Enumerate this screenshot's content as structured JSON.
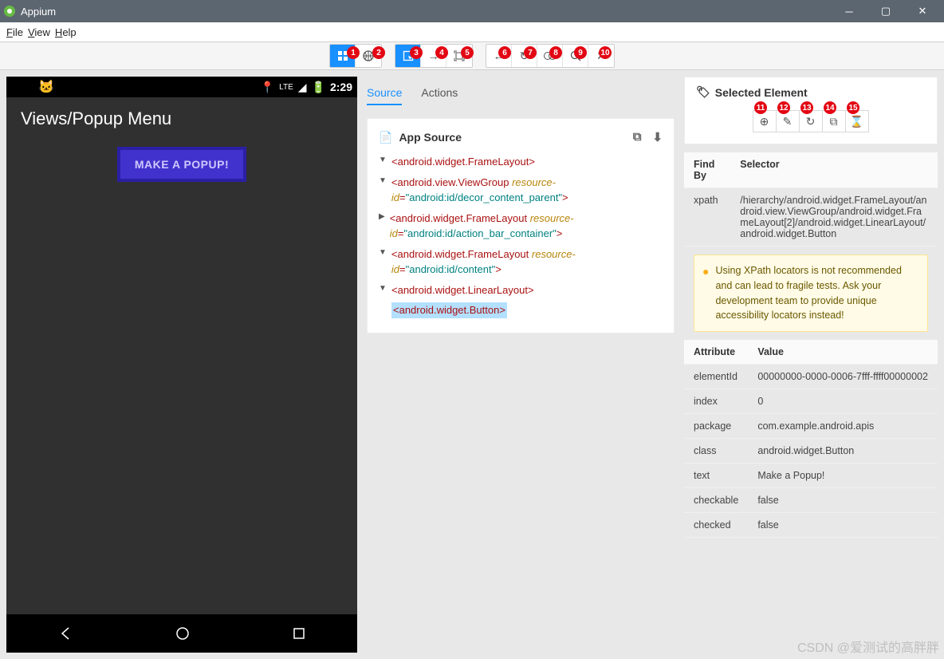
{
  "window": {
    "title": "Appium"
  },
  "menus": {
    "file": "File",
    "view": "View",
    "help": "Help"
  },
  "phone": {
    "clock": "2:29",
    "lte": "LTE",
    "page_title": "Views/Popup Menu",
    "button_label": "MAKE A POPUP!"
  },
  "tabs": {
    "source": "Source",
    "actions": "Actions"
  },
  "source_card": {
    "title": "App Source",
    "tree": {
      "n0": "android.widget.FrameLayout",
      "n1": "android.view.ViewGroup",
      "n1_attr_name": "resource-id",
      "n1_attr_val": "\"android:id/decor_content_parent\"",
      "n2": "android.widget.FrameLayout",
      "n2_attr_name": "resource-id",
      "n2_attr_val": "\"android:id/action_bar_container\"",
      "n3": "android.widget.FrameLayout",
      "n3_attr_name": "resource-id",
      "n3_attr_val": "\"android:id/content\"",
      "n4": "android.widget.LinearLayout",
      "n5": "android.widget.Button"
    }
  },
  "selected": {
    "title": "Selected Element",
    "find_th": "Find By",
    "sel_th": "Selector",
    "xpath_label": "xpath",
    "xpath_value": "/hierarchy/android.widget.FrameLayout/android.view.ViewGroup/android.widget.FrameLayout[2]/android.widget.LinearLayout/android.widget.Button",
    "warn": "Using XPath locators is not recommended and can lead to fragile tests. Ask your development team to provide unique accessibility locators instead!",
    "attr_th": "Attribute",
    "val_th": "Value",
    "rows": {
      "elementId_k": "elementId",
      "elementId_v": "00000000-0000-0006-7fff-ffff00000002",
      "index_k": "index",
      "index_v": "0",
      "package_k": "package",
      "package_v": "com.example.android.apis",
      "class_k": "class",
      "class_v": "android.widget.Button",
      "text_k": "text",
      "text_v": "Make a Popup!",
      "checkable_k": "checkable",
      "checkable_v": "false",
      "checked_k": "checked",
      "checked_v": "false"
    }
  },
  "badges": [
    "1",
    "2",
    "3",
    "4",
    "5",
    "6",
    "7",
    "8",
    "9",
    "10",
    "11",
    "12",
    "13",
    "14",
    "15"
  ],
  "watermark": "CSDN @爱测试的高胖胖"
}
